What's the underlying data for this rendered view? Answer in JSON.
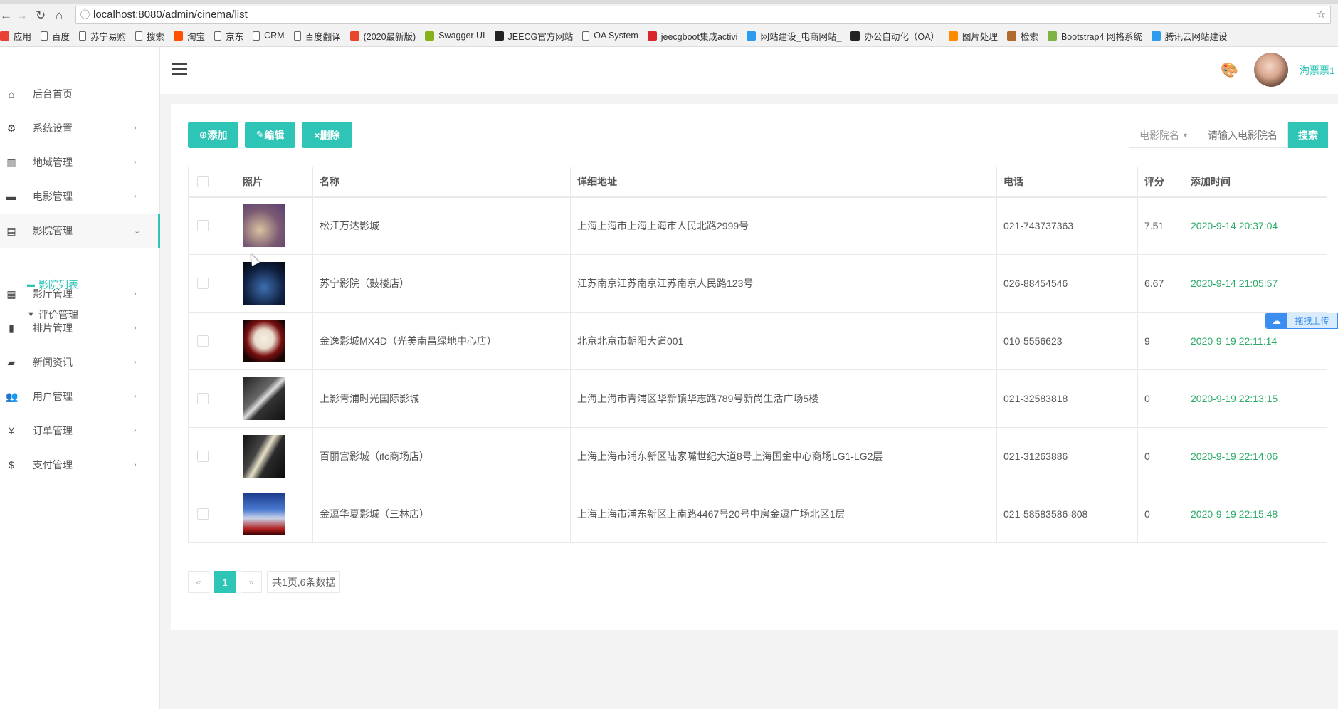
{
  "browser": {
    "url": "localhost:8080/admin/cinema/list",
    "bookmarks": [
      {
        "label": "应用",
        "icon": "apps-icon",
        "color": "#e94235"
      },
      {
        "label": "百度",
        "icon": "page-icon"
      },
      {
        "label": "苏宁易购",
        "icon": "page-icon"
      },
      {
        "label": "搜索",
        "icon": "page-icon"
      },
      {
        "label": "淘宝",
        "icon": "taobao-icon",
        "color": "#ff5000"
      },
      {
        "label": "京东",
        "icon": "page-icon"
      },
      {
        "label": "CRM",
        "icon": "page-icon"
      },
      {
        "label": "百度翻译",
        "icon": "page-icon"
      },
      {
        "label": "(2020最新版)",
        "icon": "c-icon",
        "color": "#e8472b"
      },
      {
        "label": "Swagger UI",
        "icon": "swagger-icon",
        "color": "#85b317"
      },
      {
        "label": "JEECG官方网站",
        "icon": "j-icon",
        "color": "#222222"
      },
      {
        "label": "OA System",
        "icon": "page-icon"
      },
      {
        "label": "jeecgboot集成activi",
        "icon": "g-icon",
        "color": "#d9262c"
      },
      {
        "label": "网站建设_电商网站_",
        "icon": "cloud-icon",
        "color": "#2d9cf0"
      },
      {
        "label": "办公自动化（OA）",
        "icon": "github-icon",
        "color": "#222222"
      },
      {
        "label": "图片处理",
        "icon": "image-icon",
        "color": "#ff8a00"
      },
      {
        "label": "检索",
        "icon": "zhi-icon",
        "color": "#b06a2c"
      },
      {
        "label": "Bootstrap4 网格系统",
        "icon": "bootstrap-icon",
        "color": "#7cb342"
      },
      {
        "label": "腾讯云网站建设",
        "icon": "cloud-icon",
        "color": "#2d9cf0"
      }
    ]
  },
  "colors": {
    "accent": "#2ec4b6",
    "date": "#2aab67"
  },
  "header": {
    "username": "淘票票1"
  },
  "sidebar": {
    "items": [
      {
        "label": "后台首页",
        "icon": "home-icon",
        "glyph": "⌂"
      },
      {
        "label": "系统设置",
        "icon": "gear-icon",
        "glyph": "⚙"
      },
      {
        "label": "地域管理",
        "icon": "map-icon",
        "glyph": "▥"
      },
      {
        "label": "电影管理",
        "icon": "film-icon",
        "glyph": "▬"
      },
      {
        "label": "影院管理",
        "icon": "store-icon",
        "glyph": "▤"
      },
      {
        "label": "影厅管理",
        "icon": "building-icon",
        "glyph": "▦"
      },
      {
        "label": "排片管理",
        "icon": "schedule-icon",
        "glyph": "▮"
      },
      {
        "label": "新闻资讯",
        "icon": "news-icon",
        "glyph": "▰"
      },
      {
        "label": "用户管理",
        "icon": "users-icon",
        "glyph": "👥"
      },
      {
        "label": "订单管理",
        "icon": "yen-icon",
        "glyph": "¥"
      },
      {
        "label": "支付管理",
        "icon": "dollar-icon",
        "glyph": "$"
      }
    ],
    "subitems": [
      {
        "label": "影院列表",
        "icon": "list-icon",
        "glyph": "▬"
      },
      {
        "label": "评价管理",
        "icon": "comment-icon",
        "glyph": "▼"
      }
    ]
  },
  "toolbar": {
    "add": "添加",
    "edit": "编辑",
    "delete": "删除"
  },
  "search": {
    "field": "电影院名",
    "placeholder": "请输入电影院名",
    "button": "搜索"
  },
  "table": {
    "columns": [
      "照片",
      "名称",
      "详细地址",
      "电话",
      "评分",
      "添加时间"
    ],
    "rows": [
      {
        "name": "松江万达影城",
        "address": "上海上海市上海上海市人民北路2999号",
        "phone": "021-743737363",
        "score": "7.51",
        "added": "2020-9-14 20:37:04"
      },
      {
        "name": "苏宁影院（鼓楼店）",
        "address": "江苏南京江苏南京江苏南京人民路123号",
        "phone": "026-88454546",
        "score": "6.67",
        "added": "2020-9-14 21:05:57"
      },
      {
        "name": "金逸影城MX4D（光美南昌绿地中心店）",
        "address": "北京北京市朝阳大道001",
        "phone": "010-5556623",
        "score": "9",
        "added": "2020-9-19 22:11:14"
      },
      {
        "name": "上影青浦时光国际影城",
        "address": "上海上海市青浦区华新镇华志路789号新尚生活广场5楼",
        "phone": "021-32583818",
        "score": "0",
        "added": "2020-9-19 22:13:15"
      },
      {
        "name": "百丽宫影城（ifc商场店）",
        "address": "上海上海市浦东新区陆家嘴世纪大道8号上海国金中心商场LG1-LG2层",
        "phone": "021-31263886",
        "score": "0",
        "added": "2020-9-19 22:14:06"
      },
      {
        "name": "金逗华夏影城（三林店）",
        "address": "上海上海市浦东新区上南路4467号20号中房金逗广场北区1层",
        "phone": "021-58583586-808",
        "score": "0",
        "added": "2020-9-19 22:15:48"
      }
    ]
  },
  "pagination": {
    "prev": "«",
    "current": "1",
    "next": "»",
    "info": "共1页,6条数据"
  },
  "upload_widget": {
    "label": "拖拽上传"
  }
}
